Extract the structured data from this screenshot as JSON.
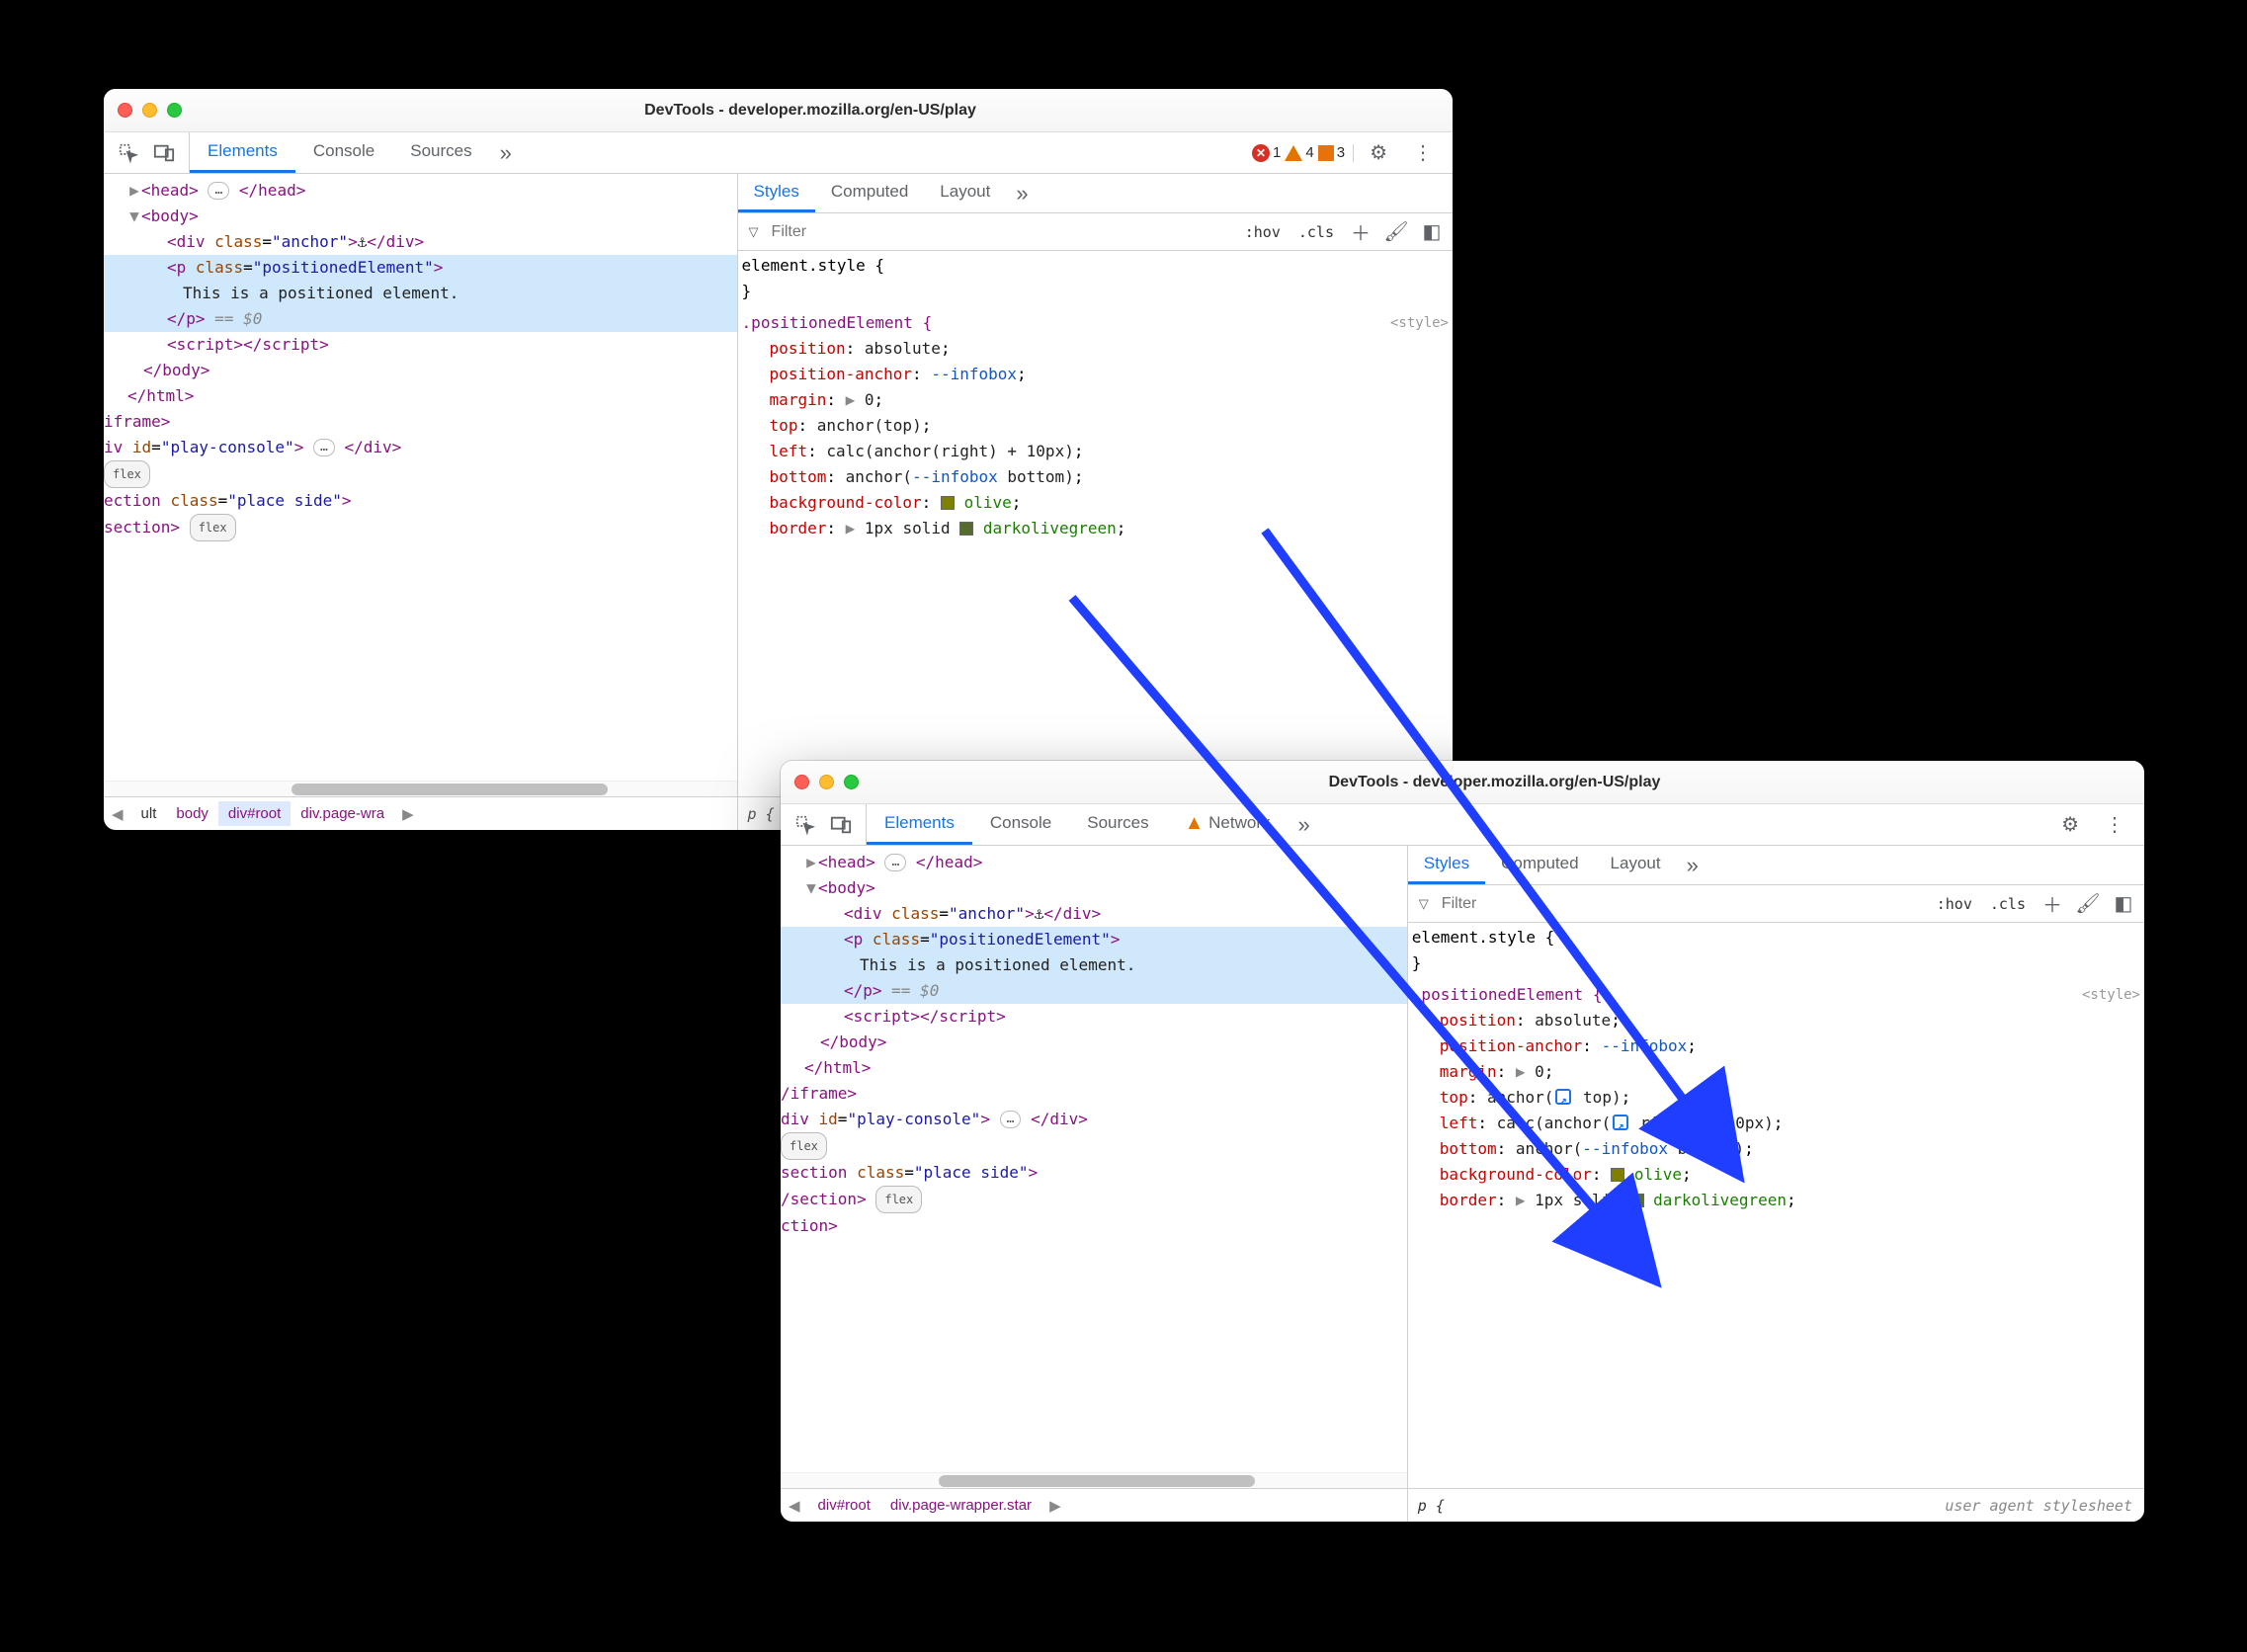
{
  "window1": {
    "title": "DevTools - developer.mozilla.org/en-US/play",
    "tabs": {
      "elements": "Elements",
      "console": "Console",
      "sources": "Sources"
    },
    "badges": {
      "errors": "1",
      "warnings": "4",
      "issues": "3"
    },
    "dom": {
      "head_open": "<head>",
      "head_ell": "…",
      "head_close": "</head>",
      "body_open": "<body>",
      "div_anchor": {
        "open": "<div ",
        "attr": "class",
        "val": "anchor",
        "close": ">",
        "anchor_char": "⚓",
        "end": "</div>"
      },
      "p": {
        "open": "<p ",
        "attr": "class",
        "val": "positionedElement",
        "close": ">",
        "text": "This is a positioned element.",
        "end": "</p>",
        "meta": "== $0"
      },
      "script": {
        "open": "<script>",
        "close": "</script>"
      },
      "body_close": "</body>",
      "html_close": "</html>",
      "iframe_close": "iframe>",
      "playdiv": {
        "open": "iv ",
        "attr": "id",
        "val": "play-console",
        "close": ">",
        "ell": "…",
        "end": "</div>"
      },
      "flex1": "flex",
      "section": {
        "open": "ection ",
        "attr": "class",
        "val": "place side",
        "close": ">"
      },
      "section_close": "section>",
      "flex2": "flex"
    },
    "breadcrumb": {
      "i0": "ult",
      "i1": "body",
      "i2": "div#root",
      "i3": "div.page-wra"
    },
    "styles": {
      "sub_tabs": {
        "styles": "Styles",
        "computed": "Computed",
        "layout": "Layout"
      },
      "filter_placeholder": "Filter",
      "hov": ":hov",
      "cls": ".cls",
      "elstyle_open": "element.style {",
      "elstyle_close": "}",
      "rule": {
        "source_label": "<style>",
        "selector": ".positionedElement {",
        "p1": {
          "prop": "position",
          "val": "absolute"
        },
        "p2": {
          "prop": "position-anchor",
          "val": "--infobox"
        },
        "p3": {
          "prop": "margin",
          "tri": "▶",
          "val": "0"
        },
        "p4": {
          "prop": "top",
          "fn": "anchor",
          "inner": "top"
        },
        "p5": {
          "prop": "left",
          "outer": "calc",
          "fn": "anchor",
          "inner": "right",
          "plus": " + 10px)"
        },
        "p6": {
          "prop": "bottom",
          "fn": "anchor",
          "arg1": "--infobox",
          "arg2": "bottom"
        },
        "p7": {
          "prop": "background-color",
          "swatch": "#808000",
          "val": "olive"
        },
        "p8": {
          "prop": "border",
          "tri": "▶",
          "v1": "1px",
          "v2": "solid",
          "swatch": "#556b2f",
          "v3": "darkolivegreen"
        }
      },
      "footer": "p {"
    }
  },
  "window2": {
    "title": "DevTools - developer.mozilla.org/en-US/play",
    "tabs": {
      "elements": "Elements",
      "console": "Console",
      "sources": "Sources",
      "network": "Network"
    },
    "dom": {
      "head_open": "<head>",
      "head_ell": "…",
      "head_close": "</head>",
      "body_open": "<body>",
      "div_anchor": {
        "open": "<div ",
        "attr": "class",
        "val": "anchor",
        "close": ">",
        "anchor_char": "⚓",
        "end": "</div>"
      },
      "p": {
        "open": "<p ",
        "attr": "class",
        "val": "positionedElement",
        "close": ">",
        "text": "This is a positioned element.",
        "end": "</p>",
        "meta": "== $0"
      },
      "script": {
        "open": "<script>",
        "close": "</script>"
      },
      "body_close": "</body>",
      "html_close": "</html>",
      "iframe_close": "/iframe>",
      "playdiv": {
        "open": "div ",
        "attr": "id",
        "val": "play-console",
        "close": ">",
        "ell": "…",
        "end": "</div>"
      },
      "flex1": "flex",
      "section": {
        "open": "section ",
        "attr": "class",
        "val": "place side",
        "close": ">"
      },
      "section_close": "/section>",
      "flex2": "flex",
      "trailing": "ction>"
    },
    "breadcrumb": {
      "i0": "div#root",
      "i1": "div.page-wrapper.star"
    },
    "styles": {
      "sub_tabs": {
        "styles": "Styles",
        "computed": "Computed",
        "layout": "Layout"
      },
      "filter_placeholder": "Filter",
      "hov": ":hov",
      "cls": ".cls",
      "elstyle_open": "element.style {",
      "elstyle_close": "}",
      "rule": {
        "source_label": "<style>",
        "selector": ".positionedElement {",
        "p1": {
          "prop": "position",
          "val": "absolute"
        },
        "p2": {
          "prop": "position-anchor",
          "val": "--infobox"
        },
        "p3": {
          "prop": "margin",
          "tri": "▶",
          "val": "0"
        },
        "p4": {
          "prop": "top",
          "fn": "anchor",
          "inner": "top"
        },
        "p5": {
          "prop": "left",
          "outer": "calc",
          "fn": "anchor",
          "inner": "right",
          "plus": " + 10px)"
        },
        "p6": {
          "prop": "bottom",
          "fn": "anchor",
          "arg1": "--infobox",
          "arg2": "bottom"
        },
        "p7": {
          "prop": "background-color",
          "swatch": "#808000",
          "val": "olive"
        },
        "p8": {
          "prop": "border",
          "tri": "▶",
          "v1": "1px",
          "v2": "solid",
          "swatch": "#556b2f",
          "v3": "darkolivegreen"
        }
      },
      "footer_sel": "p {",
      "footer_uas": "user agent stylesheet"
    }
  },
  "arrows_color": "#1f3eff"
}
